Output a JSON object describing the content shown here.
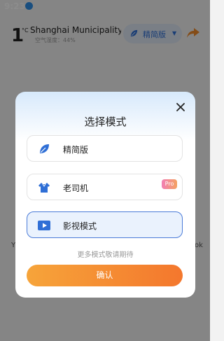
{
  "status_bar": {
    "time": "9:23",
    "download_icon": "download-arrow-icon"
  },
  "header": {
    "temperature": "1",
    "temp_unit": "°C",
    "city": "Shanghai Municipality  Ch",
    "humidity": "空气湿度：44%",
    "mode_pill": {
      "label": "精简版",
      "icon": "leaf-icon"
    },
    "share_icon": "share-arrow-icon",
    "accent_color": "#2f6fd6"
  },
  "background_fragments": {
    "left": "Y",
    "right": "ok"
  },
  "dialog": {
    "title": "选择模式",
    "close_icon": "close-icon",
    "options": [
      {
        "label": "精简版",
        "icon": "leaf-icon",
        "selected": false
      },
      {
        "label": "老司机",
        "icon": "shirt-icon",
        "badge": "Pro",
        "selected": false
      },
      {
        "label": "影视模式",
        "icon": "play-icon",
        "selected": true
      }
    ],
    "more_hint": "更多模式敬请期待",
    "confirm_label": "确认",
    "selected_border_color": "#4a7bd8",
    "confirm_color": "#f6a43a"
  }
}
